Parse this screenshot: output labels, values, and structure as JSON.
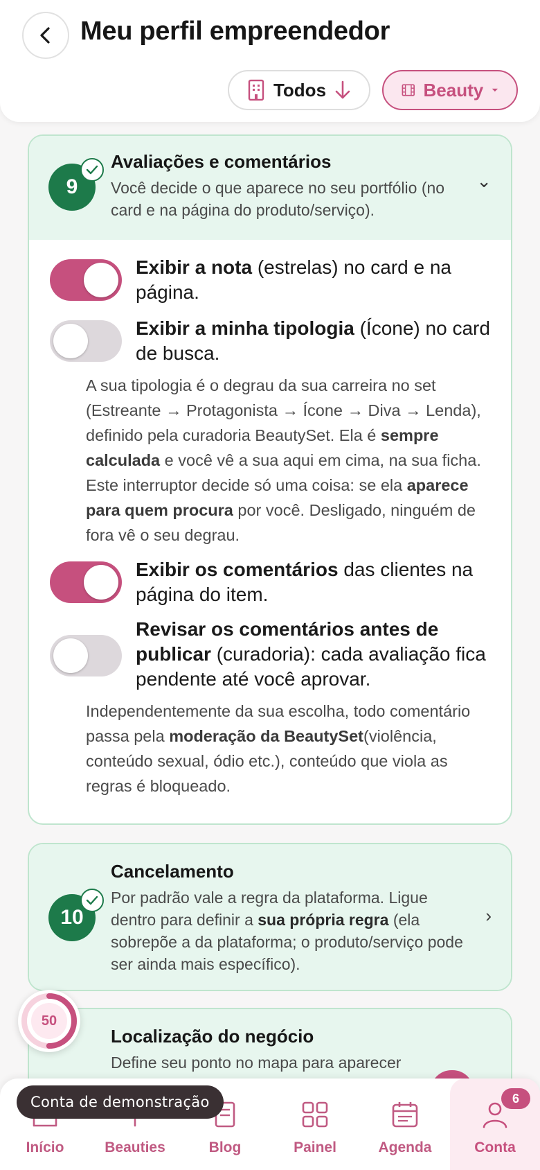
{
  "header": {
    "title": "Meu perfil empreendedor",
    "filter_todos": "Todos",
    "filter_category": "Beauty"
  },
  "section_reviews": {
    "step": "9",
    "title": "Avaliações e comentários",
    "description": "Você decide o que aparece no seu portfólio (no card e na página do produto/serviço).",
    "toggles": [
      {
        "on": true,
        "bold": "Exibir a nota",
        "rest": " (estrelas) no card e na página."
      },
      {
        "on": false,
        "bold": "Exibir a minha tipologia",
        "rest": " (Ícone) no card de busca."
      },
      {
        "on": true,
        "bold": "Exibir os comentários",
        "rest": " das clientes na página do item."
      },
      {
        "on": false,
        "bold": "Revisar os comentários antes de publicar",
        "rest": " (curadoria): cada avaliação fica pendente até você aprovar."
      }
    ],
    "typology_note": {
      "part1": "A sua tipologia é o degrau da sua carreira no set (Estreante → Protagonista → Ícone → Diva → Lenda), definido pela curadoria BeautySet. Ela é ",
      "bold1": "sempre calculada",
      "part2": " e você vê a sua aqui em cima, na sua ficha. Este interruptor decide só uma coisa: se ela ",
      "bold2": "aparece para quem procura",
      "part3": " por você. Desligado, ninguém de fora vê o seu degrau."
    },
    "moderation_note": {
      "part1": "Independentemente da sua escolha, todo comentário passa pela ",
      "bold1": "moderação da BeautySet",
      "part2": "(violência, conteúdo sexual, ódio etc.), conteúdo que viola as regras é bloqueado."
    }
  },
  "section_cancel": {
    "step": "10",
    "title": "Cancelamento",
    "desc_part1": "Por padrão vale a regra da plataforma. Ligue dentro para definir a ",
    "desc_bold": "sua própria regra",
    "desc_part2": " (ela sobrepõe a da plataforma; o produto/serviço pode ser ainda mais específico)."
  },
  "section_location": {
    "title": "Localização do negócio",
    "description": "Define seu ponto no mapa para aparecer"
  },
  "progress": {
    "value": "50",
    "fraction": 0.5
  },
  "demo_toast": "Conta de demonstração",
  "nav": {
    "items": [
      {
        "label": "Início",
        "icon": "home-icon"
      },
      {
        "label": "Beauties",
        "icon": "beauties-icon"
      },
      {
        "label": "Blog",
        "icon": "blog-icon"
      },
      {
        "label": "Painel",
        "icon": "grid-icon"
      },
      {
        "label": "Agenda",
        "icon": "calendar-icon"
      },
      {
        "label": "Conta",
        "icon": "user-icon"
      }
    ],
    "account_badge": "6"
  },
  "colors": {
    "accent": "#c6507e",
    "success": "#1d7a4a",
    "card_head": "#e7f6ee"
  }
}
